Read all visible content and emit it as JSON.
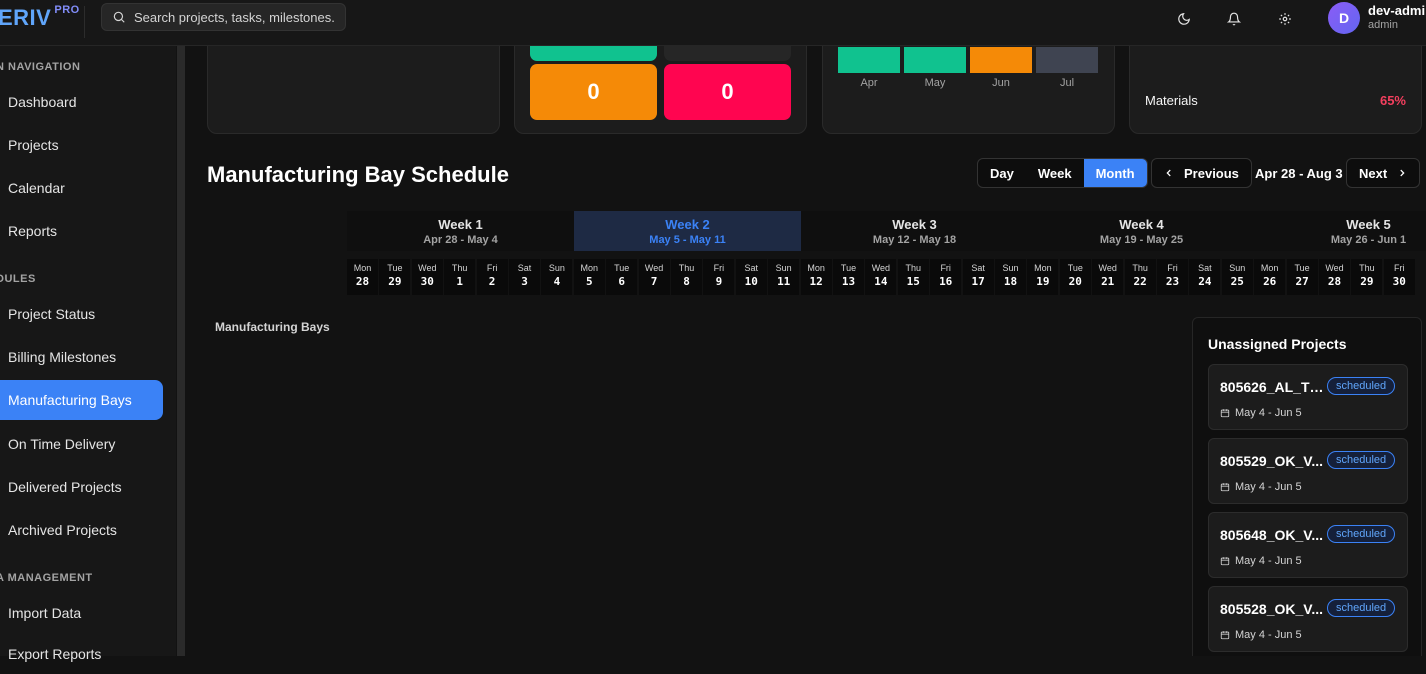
{
  "app": {
    "logo": "ERIV",
    "logo_badge": "PRO"
  },
  "topbar": {
    "search_placeholder": "Search projects, tasks, milestones...",
    "icons": [
      "moon-icon",
      "bell-icon",
      "gear-icon"
    ],
    "user": {
      "initial": "D",
      "name": "dev-admin",
      "role": "admin"
    }
  },
  "sidebar": {
    "sections": [
      {
        "title": "N NAVIGATION",
        "items": [
          "Dashboard",
          "Projects",
          "Calendar",
          "Reports"
        ]
      },
      {
        "title": "DULES",
        "items": [
          "Project Status",
          "Billing Milestones",
          "Manufacturing Bays",
          "On Time Delivery",
          "Delivered Projects",
          "Archived Projects"
        ]
      },
      {
        "title": "A MANAGEMENT",
        "items": [
          "Import Data",
          "Export Reports"
        ]
      }
    ],
    "active_item": "Manufacturing Bays"
  },
  "cards": {
    "stats": [
      "0",
      "0"
    ],
    "bar_chart": {
      "months": [
        "Apr",
        "May",
        "Jun",
        "Jul"
      ],
      "colors": [
        "#10c28f",
        "#10c28f",
        "#f58a07",
        "#3f4451"
      ]
    },
    "materials": {
      "label": "Materials",
      "value": "65%"
    }
  },
  "schedule": {
    "title": "Manufacturing Bay Schedule",
    "views": [
      "Day",
      "Week",
      "Month"
    ],
    "active_view": "Month",
    "prev_label": "Previous",
    "next_label": "Next",
    "range": "Apr 28 - Aug 3",
    "weeks": [
      {
        "name": "Week 1",
        "range": "Apr 28 - May 4"
      },
      {
        "name": "Week 2",
        "range": "May 5 - May 11",
        "current": true
      },
      {
        "name": "Week 3",
        "range": "May 12 - May 18"
      },
      {
        "name": "Week 4",
        "range": "May 19 - May 25"
      },
      {
        "name": "Week 5",
        "range": "May 26 - Jun 1"
      }
    ],
    "days": [
      [
        "Mon",
        "28"
      ],
      [
        "Tue",
        "29"
      ],
      [
        "Wed",
        "30"
      ],
      [
        "Thu",
        "1"
      ],
      [
        "Fri",
        "2"
      ],
      [
        "Sat",
        "3"
      ],
      [
        "Sun",
        "4"
      ],
      [
        "Mon",
        "5"
      ],
      [
        "Tue",
        "6"
      ],
      [
        "Wed",
        "7"
      ],
      [
        "Thu",
        "8"
      ],
      [
        "Fri",
        "9"
      ],
      [
        "Sat",
        "10"
      ],
      [
        "Sun",
        "11"
      ],
      [
        "Mon",
        "12"
      ],
      [
        "Tue",
        "13"
      ],
      [
        "Wed",
        "14"
      ],
      [
        "Thu",
        "15"
      ],
      [
        "Fri",
        "16"
      ],
      [
        "Sat",
        "17"
      ],
      [
        "Sun",
        "18"
      ],
      [
        "Mon",
        "19"
      ],
      [
        "Tue",
        "20"
      ],
      [
        "Wed",
        "21"
      ],
      [
        "Thu",
        "22"
      ],
      [
        "Fri",
        "23"
      ],
      [
        "Sat",
        "24"
      ],
      [
        "Sun",
        "25"
      ],
      [
        "Mon",
        "26"
      ],
      [
        "Tue",
        "27"
      ],
      [
        "Wed",
        "28"
      ],
      [
        "Thu",
        "29"
      ],
      [
        "Fri",
        "30"
      ]
    ],
    "bays_label": "Manufacturing Bays"
  },
  "unassigned": {
    "title": "Unassigned Projects",
    "projects": [
      {
        "name": "805626_AL_TC...",
        "status": "scheduled",
        "dates": "May 4 - Jun 5"
      },
      {
        "name": "805529_OK_V...",
        "status": "scheduled",
        "dates": "May 4 - Jun 5"
      },
      {
        "name": "805648_OK_V...",
        "status": "scheduled",
        "dates": "May 4 - Jun 5"
      },
      {
        "name": "805528_OK_V...",
        "status": "scheduled",
        "dates": "May 4 - Jun 5"
      }
    ]
  }
}
